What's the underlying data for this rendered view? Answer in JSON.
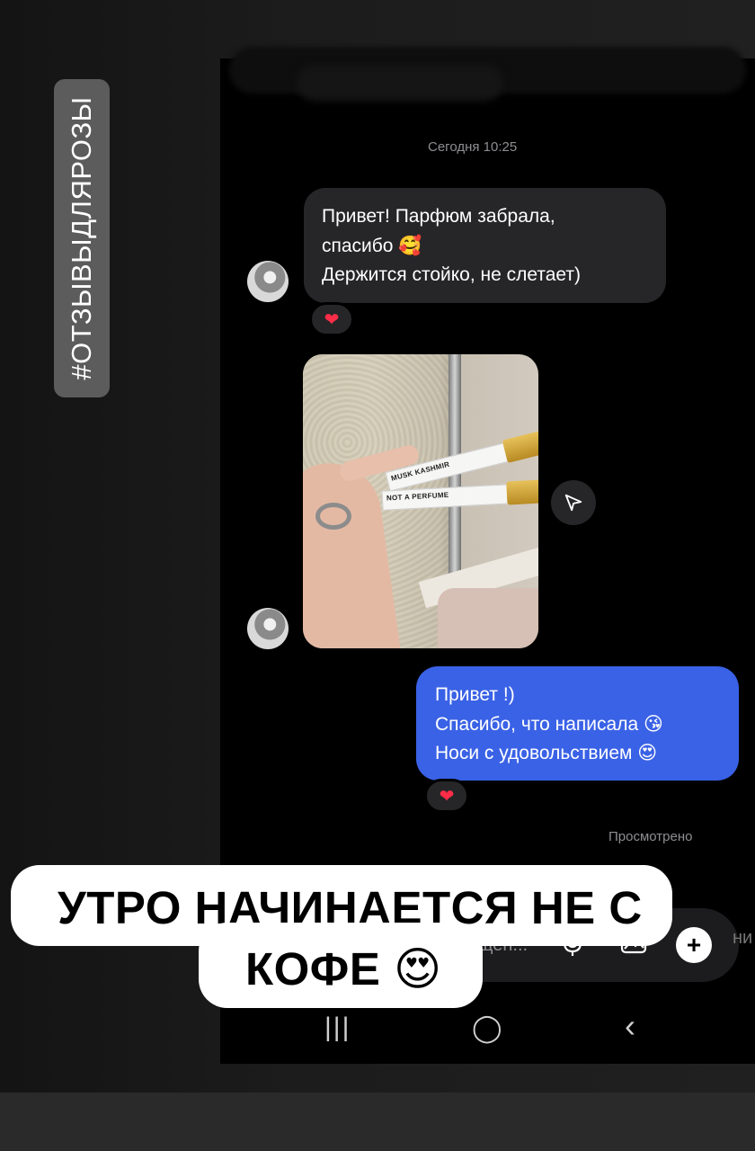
{
  "story": {
    "hashtag": "#ОТЗЫВЫДЛЯРОЗЫ",
    "caption_line1": "УТРО НАЧИНАЕТСЯ НЕ С",
    "caption_line2": "КОФЕ 😍"
  },
  "chat": {
    "timestamp": "Сегодня 10:25",
    "incoming_message": {
      "lines": [
        "Привет! Парфюм забрала,",
        "спасибо 🥰",
        "Держится стойко, не слетает)"
      ],
      "reaction": "❤"
    },
    "photo": {
      "vial_labels": [
        "MUSK KASHMIR",
        "NOT A PERFUME"
      ]
    },
    "outgoing_message": {
      "lines": [
        "Привет !)",
        "Спасибо, что написала 😘",
        "Носи с удовольствием 😍"
      ],
      "reaction": "❤"
    },
    "seen_status": "Просмотрено",
    "composer": {
      "placeholder": "щен...",
      "icons": [
        "microphone-icon",
        "gallery-icon",
        "plus-icon"
      ]
    }
  },
  "navbar": {
    "recents": "|||",
    "home": "◯",
    "back": "‹"
  },
  "colors": {
    "outgoing_bubble": "#3a62e6",
    "incoming_bubble": "#262629",
    "reaction_heart": "#ff2d48"
  }
}
